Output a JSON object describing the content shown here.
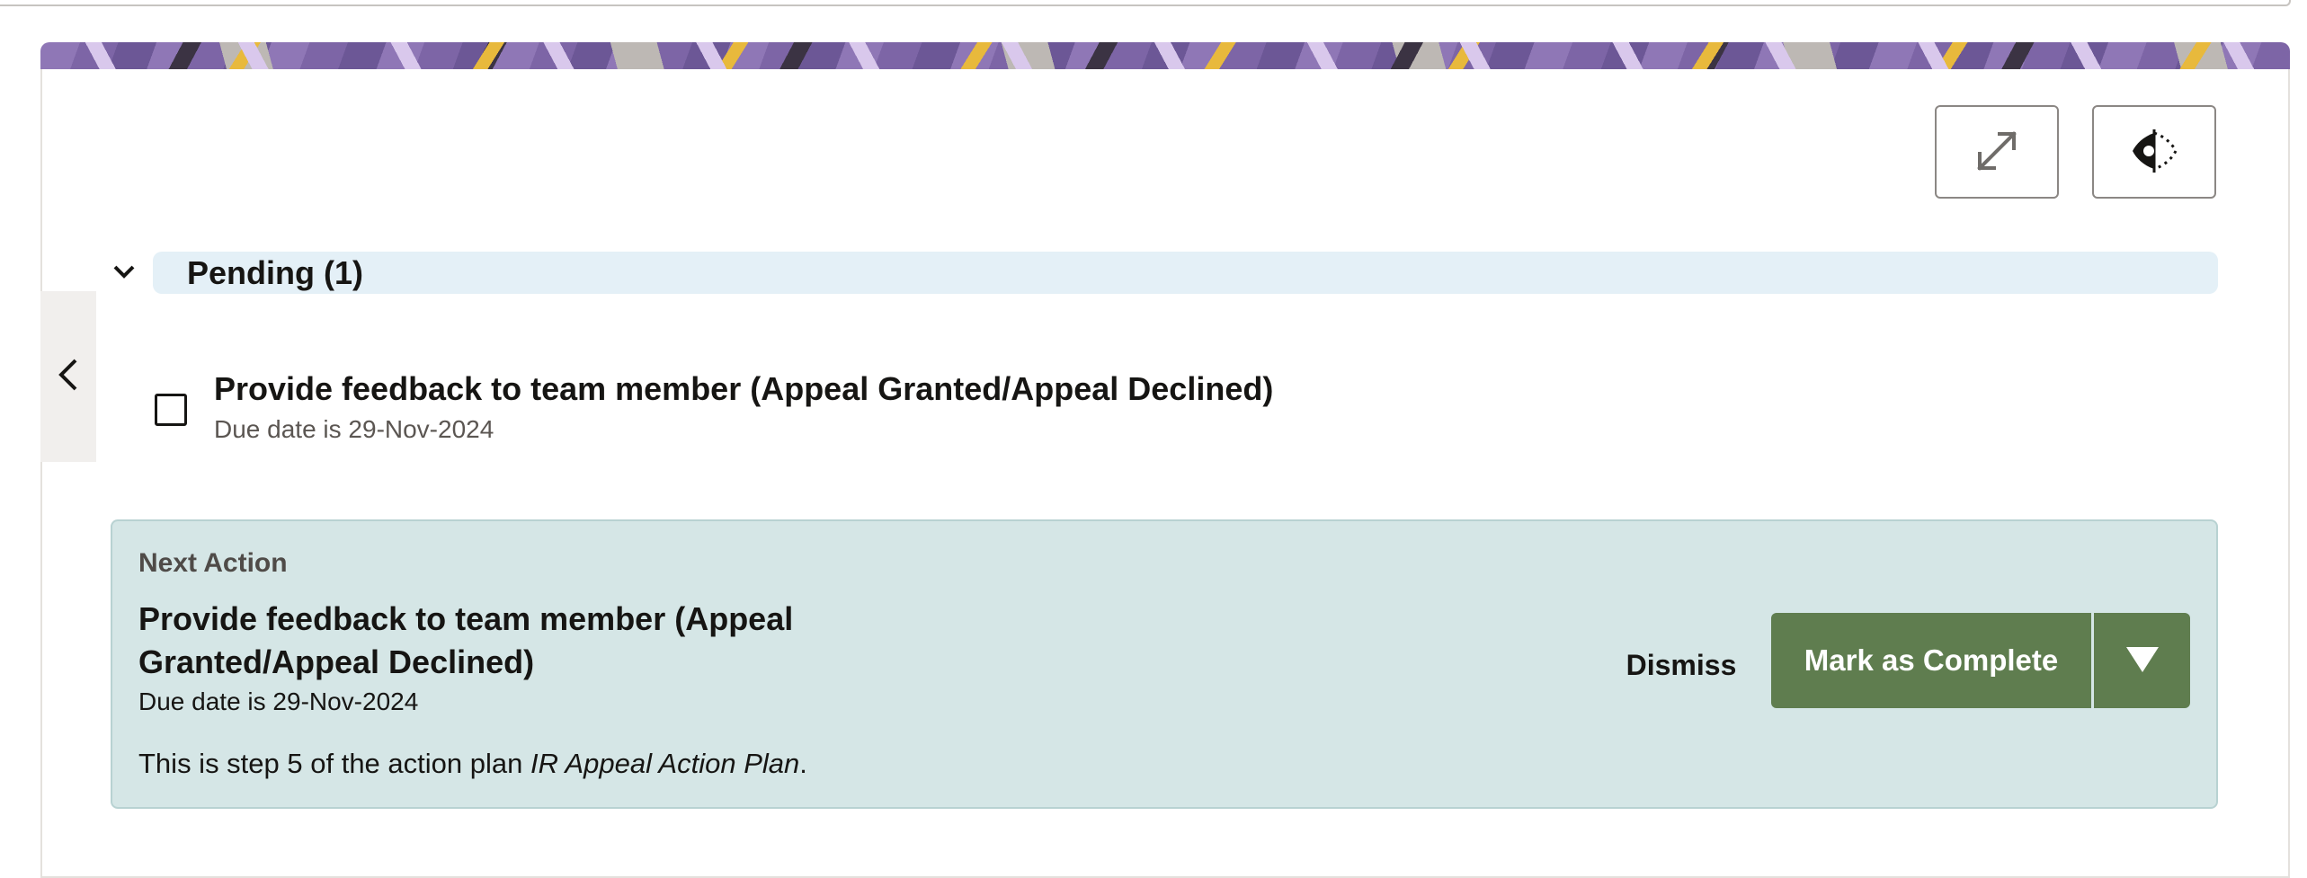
{
  "colors": {
    "accent_green": "#5f7d4f",
    "pending_band": "#e4f0f7",
    "next_panel": "#d5e6e6"
  },
  "toolbar": {
    "expand_icon": "expand-icon",
    "eye_icon": "visibility-toggle-icon"
  },
  "sidebar": {
    "collapse_icon": "chevron-left-icon"
  },
  "pending": {
    "chevron_icon": "chevron-down-icon",
    "title": "Pending (1)",
    "tasks": [
      {
        "title": "Provide feedback to team member (Appeal Granted/Appeal Declined)",
        "due": "Due date is 29-Nov-2024",
        "checked": false
      }
    ]
  },
  "next_action": {
    "label": "Next Action",
    "title": "Provide feedback to team member (Appeal Granted/Appeal Declined)",
    "due": "Due date is 29-Nov-2024",
    "desc_prefix": "This is step 5 of the action plan ",
    "plan_name": "IR Appeal Action Plan",
    "desc_suffix": ".",
    "dismiss_label": "Dismiss",
    "complete_label": "Mark as Complete",
    "menu_icon": "caret-down-icon"
  }
}
